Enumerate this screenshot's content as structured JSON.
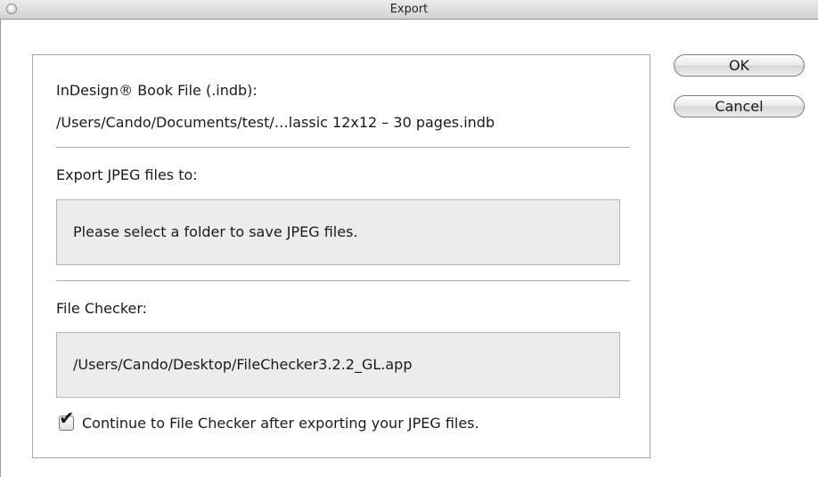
{
  "window": {
    "title": "Export"
  },
  "book_file": {
    "label": "InDesign® Book File (.indb):",
    "path": "/Users/Cando/Documents/test/…lassic 12x12 – 30 pages.indb"
  },
  "export_to": {
    "label": "Export JPEG files to:",
    "value": "Please select a folder to save JPEG files."
  },
  "file_checker": {
    "label": "File Checker:",
    "value": "/Users/Cando/Desktop/FileChecker3.2.2_GL.app"
  },
  "continue_option": {
    "checked": true,
    "label": "Continue to File Checker after exporting your JPEG files."
  },
  "buttons": {
    "ok_label": "OK",
    "cancel_label": "Cancel"
  }
}
